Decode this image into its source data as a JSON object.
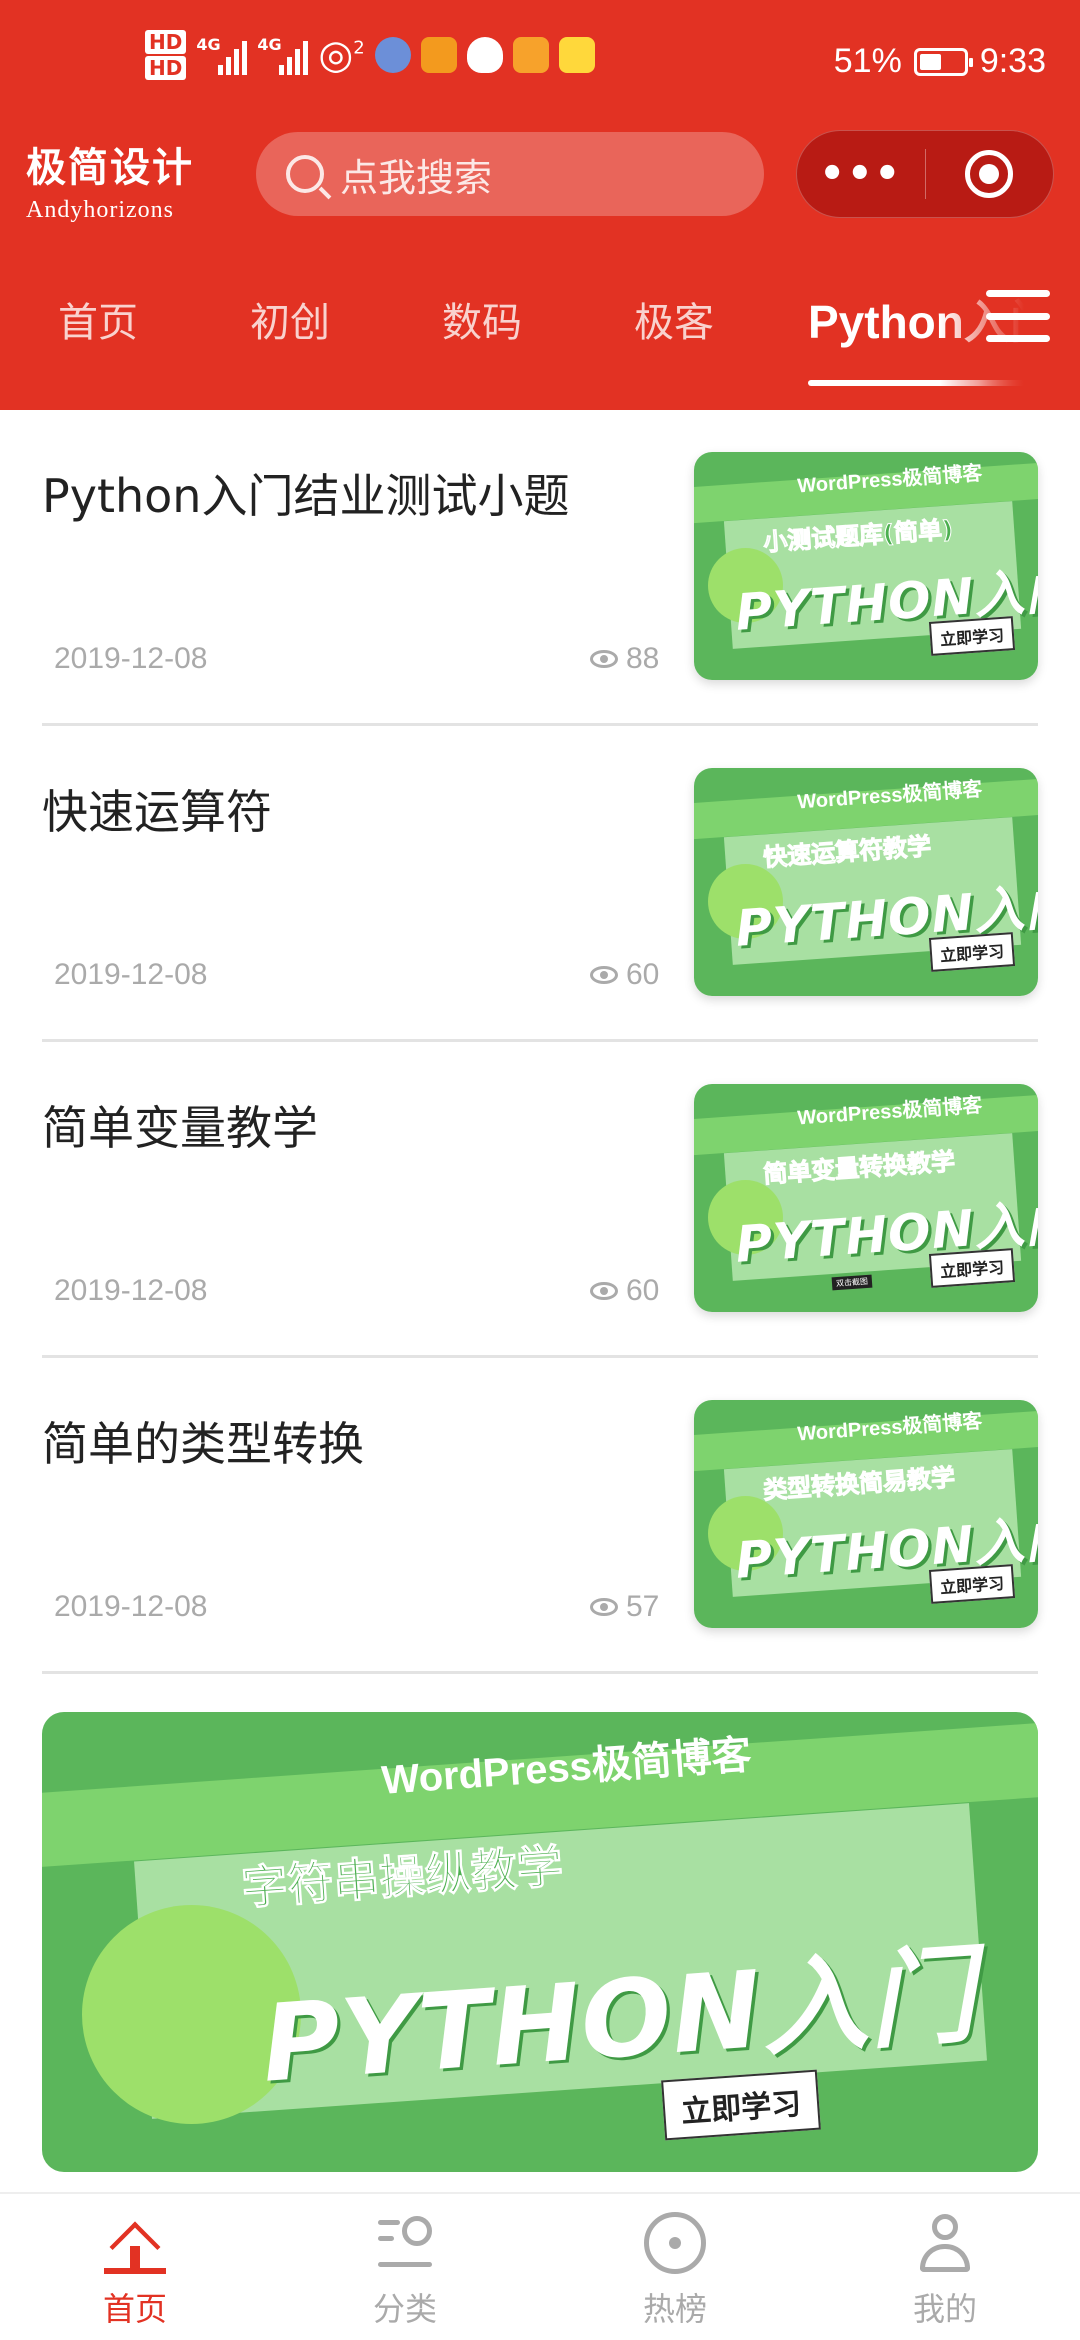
{
  "status_bar": {
    "hd_labels": [
      "HD",
      "HD"
    ],
    "network_labels": [
      "4G",
      "4G"
    ],
    "wifi_sub": "2",
    "battery_percent": "51%",
    "battery_level": 0.51,
    "time": "9:33"
  },
  "header": {
    "brand_cn": "极简设计",
    "brand_en": "Andyhorizons",
    "search_placeholder": "点我搜索",
    "capsule_more": "•••"
  },
  "tabs": [
    {
      "label": "首页",
      "active": false
    },
    {
      "label": "初创",
      "active": false
    },
    {
      "label": "数码",
      "active": false
    },
    {
      "label": "极客",
      "active": false
    },
    {
      "label": "Python入门",
      "active": true
    }
  ],
  "articles": [
    {
      "title": "Python入门结业测试小题",
      "date": "2019-12-08",
      "views": "88",
      "thumb": {
        "brand": "WordPress极简博客",
        "subtitle": "小测试题库(简单)",
        "headline": "PYTHON入门",
        "cta": "立即学习"
      }
    },
    {
      "title": "快速运算符",
      "date": "2019-12-08",
      "views": "60",
      "thumb": {
        "brand": "WordPress极简博客",
        "subtitle": "快速运算符教学",
        "headline": "PYTHON入门",
        "cta": "立即学习"
      }
    },
    {
      "title": "简单变量教学",
      "date": "2019-12-08",
      "views": "60",
      "thumb": {
        "brand": "WordPress极简博客",
        "subtitle": "简单变量转换教学",
        "headline": "PYTHON入门",
        "cta": "立即学习",
        "note": "双击截图"
      }
    },
    {
      "title": "简单的类型转换",
      "date": "2019-12-08",
      "views": "57",
      "thumb": {
        "brand": "WordPress极简博客",
        "subtitle": "类型转换简易教学",
        "headline": "PYTHON入门",
        "cta": "立即学习"
      }
    }
  ],
  "banner": {
    "brand": "WordPress极简博客",
    "subtitle": "字符串操纵教学",
    "headline": "PYTHON入门",
    "cta": "立即学习"
  },
  "bottom_nav": [
    {
      "label": "首页",
      "icon": "home-icon",
      "active": true
    },
    {
      "label": "分类",
      "icon": "category-icon",
      "active": false
    },
    {
      "label": "热榜",
      "icon": "hot-icon",
      "active": false
    },
    {
      "label": "我的",
      "icon": "profile-icon",
      "active": false
    }
  ],
  "colors": {
    "brand_red": "#e23223",
    "card_green": "#5bb65b",
    "muted_gray": "#aaaaaa"
  }
}
